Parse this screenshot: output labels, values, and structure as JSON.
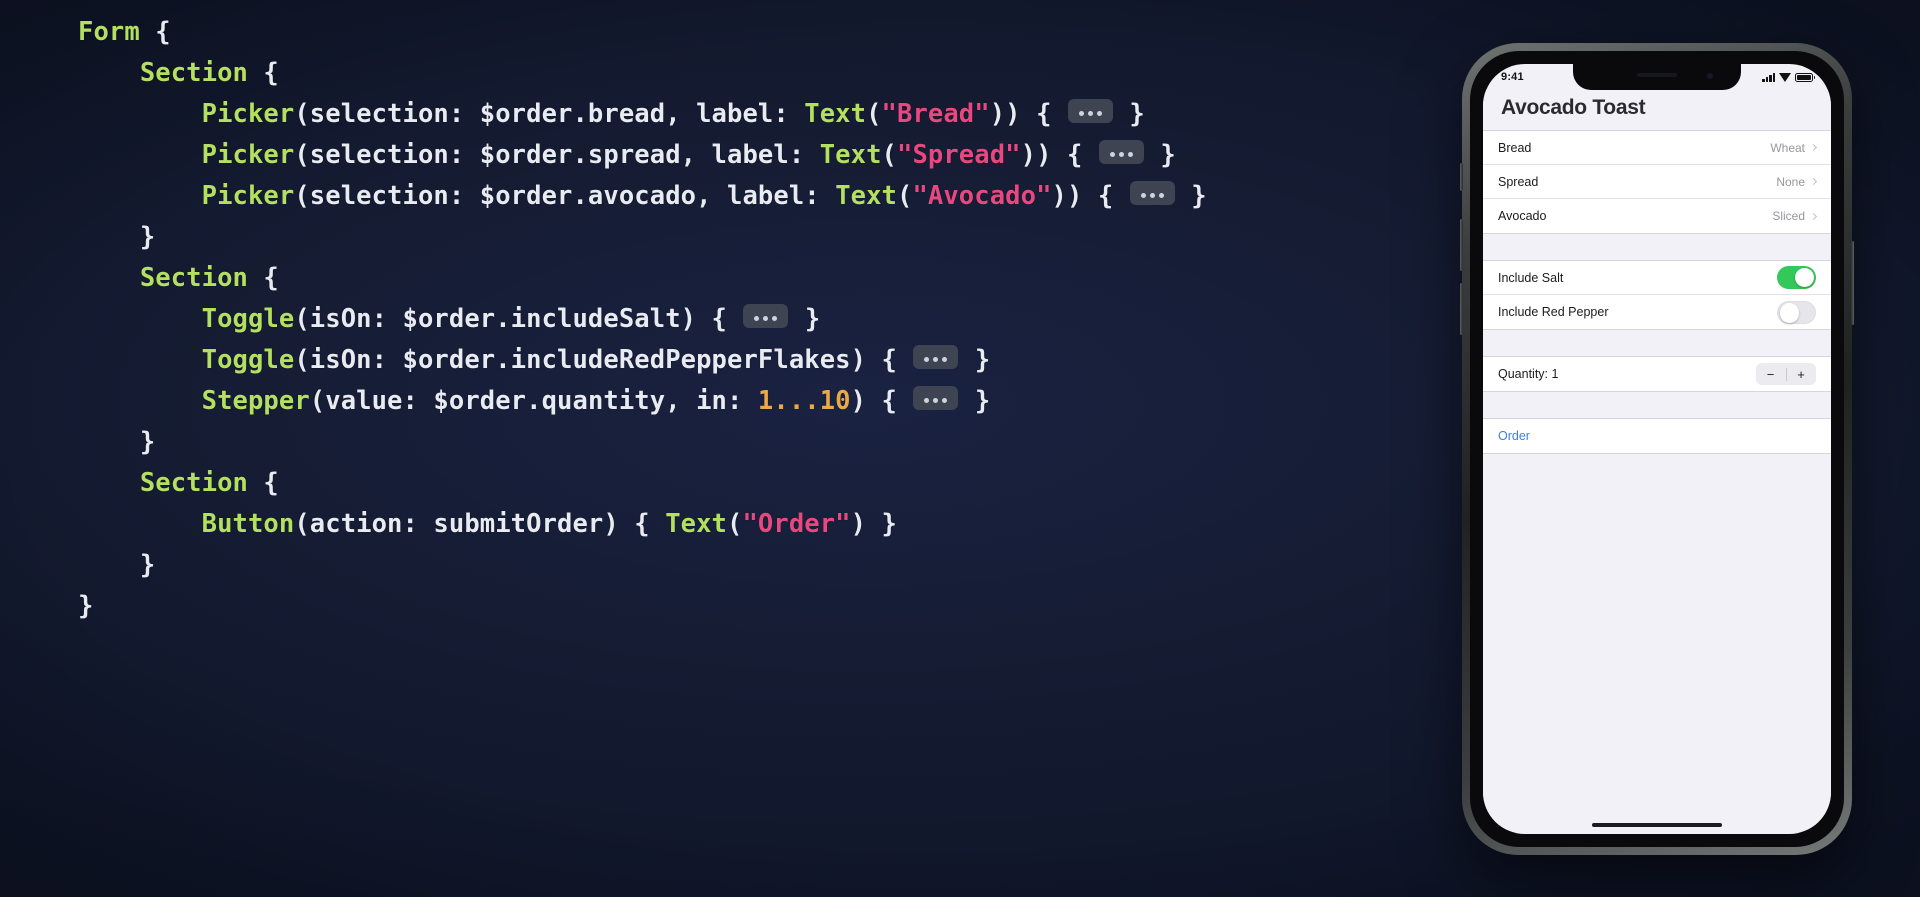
{
  "theme": {
    "background": "#151c33",
    "code_type_color": "#b4e061",
    "code_plain_color": "#e9ebf2",
    "code_string_color": "#e8487f",
    "code_number_color": "#e9a84b",
    "ios_accent": "#3f7fd4",
    "toggle_on_color": "#34c759"
  },
  "code": {
    "lines": [
      {
        "indent": 0,
        "tokens": [
          {
            "t": "type",
            "v": "Form"
          },
          {
            "t": "plain",
            "v": " {"
          }
        ]
      },
      {
        "indent": 1,
        "tokens": [
          {
            "t": "type",
            "v": "Section"
          },
          {
            "t": "plain",
            "v": " {"
          }
        ]
      },
      {
        "indent": 2,
        "tokens": [
          {
            "t": "type",
            "v": "Picker"
          },
          {
            "t": "plain",
            "v": "(selection: $order.bread, label: "
          },
          {
            "t": "type",
            "v": "Text"
          },
          {
            "t": "plain",
            "v": "("
          },
          {
            "t": "str",
            "v": "\"Bread\""
          },
          {
            "t": "plain",
            "v": ")) { "
          },
          {
            "t": "chip",
            "v": "..."
          },
          {
            "t": "plain",
            "v": " }"
          }
        ]
      },
      {
        "indent": 2,
        "tokens": [
          {
            "t": "type",
            "v": "Picker"
          },
          {
            "t": "plain",
            "v": "(selection: $order.spread, label: "
          },
          {
            "t": "type",
            "v": "Text"
          },
          {
            "t": "plain",
            "v": "("
          },
          {
            "t": "str",
            "v": "\"Spread\""
          },
          {
            "t": "plain",
            "v": ")) { "
          },
          {
            "t": "chip",
            "v": "..."
          },
          {
            "t": "plain",
            "v": " }"
          }
        ]
      },
      {
        "indent": 2,
        "tokens": [
          {
            "t": "type",
            "v": "Picker"
          },
          {
            "t": "plain",
            "v": "(selection: $order.avocado, label: "
          },
          {
            "t": "type",
            "v": "Text"
          },
          {
            "t": "plain",
            "v": "("
          },
          {
            "t": "str",
            "v": "\"Avocado\""
          },
          {
            "t": "plain",
            "v": ")) { "
          },
          {
            "t": "chip",
            "v": "..."
          },
          {
            "t": "plain",
            "v": " }"
          }
        ]
      },
      {
        "indent": 1,
        "tokens": [
          {
            "t": "plain",
            "v": "}"
          }
        ]
      },
      {
        "indent": 1,
        "tokens": [
          {
            "t": "type",
            "v": "Section"
          },
          {
            "t": "plain",
            "v": " {"
          }
        ]
      },
      {
        "indent": 2,
        "tokens": [
          {
            "t": "type",
            "v": "Toggle"
          },
          {
            "t": "plain",
            "v": "(isOn: $order.includeSalt) { "
          },
          {
            "t": "chip",
            "v": "..."
          },
          {
            "t": "plain",
            "v": " }"
          }
        ]
      },
      {
        "indent": 2,
        "tokens": [
          {
            "t": "type",
            "v": "Toggle"
          },
          {
            "t": "plain",
            "v": "(isOn: $order.includeRedPepperFlakes) { "
          },
          {
            "t": "chip",
            "v": "..."
          },
          {
            "t": "plain",
            "v": " }"
          }
        ]
      },
      {
        "indent": 2,
        "tokens": [
          {
            "t": "type",
            "v": "Stepper"
          },
          {
            "t": "plain",
            "v": "(value: $order.quantity, in: "
          },
          {
            "t": "num",
            "v": "1...10"
          },
          {
            "t": "plain",
            "v": ") { "
          },
          {
            "t": "chip",
            "v": "..."
          },
          {
            "t": "plain",
            "v": " }"
          }
        ]
      },
      {
        "indent": 1,
        "tokens": [
          {
            "t": "plain",
            "v": "}"
          }
        ]
      },
      {
        "indent": 1,
        "tokens": [
          {
            "t": "type",
            "v": "Section"
          },
          {
            "t": "plain",
            "v": " {"
          }
        ]
      },
      {
        "indent": 2,
        "tokens": [
          {
            "t": "type",
            "v": "Button"
          },
          {
            "t": "plain",
            "v": "(action: submitOrder) { "
          },
          {
            "t": "type",
            "v": "Text"
          },
          {
            "t": "plain",
            "v": "("
          },
          {
            "t": "str",
            "v": "\"Order\""
          },
          {
            "t": "plain",
            "v": ") }"
          }
        ]
      },
      {
        "indent": 1,
        "tokens": [
          {
            "t": "plain",
            "v": "}"
          }
        ]
      },
      {
        "indent": 0,
        "tokens": [
          {
            "t": "plain",
            "v": "}"
          }
        ]
      }
    ]
  },
  "phone": {
    "status": {
      "time": "9:41",
      "signal_icon": "cellular-signal-icon",
      "wifi_icon": "wifi-icon",
      "battery_icon": "battery-icon"
    },
    "nav_title": "Avocado Toast",
    "sections": [
      {
        "type": "pickers",
        "rows": [
          {
            "label": "Bread",
            "value": "Wheat",
            "accessory": "chevron-right-icon"
          },
          {
            "label": "Spread",
            "value": "None",
            "accessory": "chevron-right-icon"
          },
          {
            "label": "Avocado",
            "value": "Sliced",
            "accessory": "chevron-right-icon"
          }
        ]
      },
      {
        "type": "toggles",
        "rows": [
          {
            "label": "Include Salt",
            "state": "on"
          },
          {
            "label": "Include Red Pepper",
            "state": "off"
          }
        ]
      },
      {
        "type": "stepper",
        "rows": [
          {
            "label": "Quantity: 1",
            "decrement": "−",
            "increment": "+"
          }
        ]
      },
      {
        "type": "action",
        "rows": [
          {
            "label": "Order"
          }
        ]
      }
    ]
  }
}
